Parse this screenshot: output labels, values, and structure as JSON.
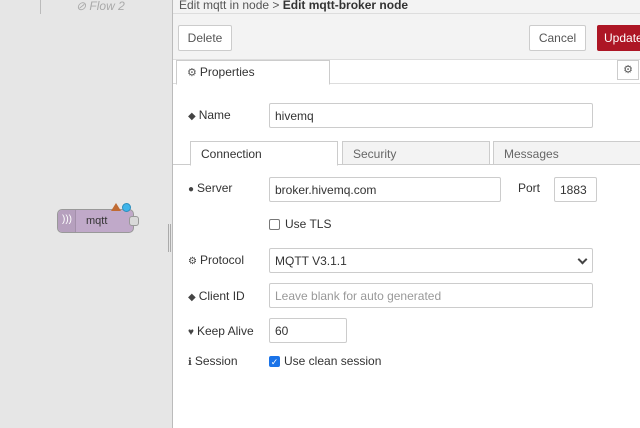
{
  "workspace": {
    "flow_tab_label": "Flow 2",
    "node_label": "mqtt"
  },
  "tray": {
    "breadcrumb_prefix": "Edit mqtt in node > ",
    "breadcrumb_current": "Edit mqtt-broker node",
    "delete_label": "Delete",
    "cancel_label": "Cancel",
    "update_label": "Update",
    "properties_tab_label": "Properties"
  },
  "form": {
    "name_label": "Name",
    "name_value": "hivemq",
    "subtabs": [
      "Connection",
      "Security",
      "Messages"
    ],
    "server_label": "Server",
    "server_value": "broker.hivemq.com",
    "port_label": "Port",
    "port_value": "1883",
    "use_tls_label": "Use TLS",
    "use_tls_checked": false,
    "protocol_label": "Protocol",
    "protocol_value": "MQTT V3.1.1",
    "client_id_label": "Client ID",
    "client_id_placeholder": "Leave blank for auto generated",
    "keep_alive_label": "Keep Alive",
    "keep_alive_value": "60",
    "session_label": "Session",
    "clean_session_label": "Use clean session",
    "clean_session_checked": true
  },
  "colors": {
    "accent": "#ad1625",
    "node_fill": "#c0a9c9",
    "status_dot": "#3fb4e9",
    "checkbox_checked": "#1a73e8"
  },
  "icons": [
    "flow-disabled-icon",
    "mqtt-node-icon",
    "gear-icon",
    "tag-icon",
    "globe-icon",
    "heartbeat-icon",
    "info-icon",
    "chevron-down-icon",
    "check-icon",
    "warning-icon"
  ]
}
